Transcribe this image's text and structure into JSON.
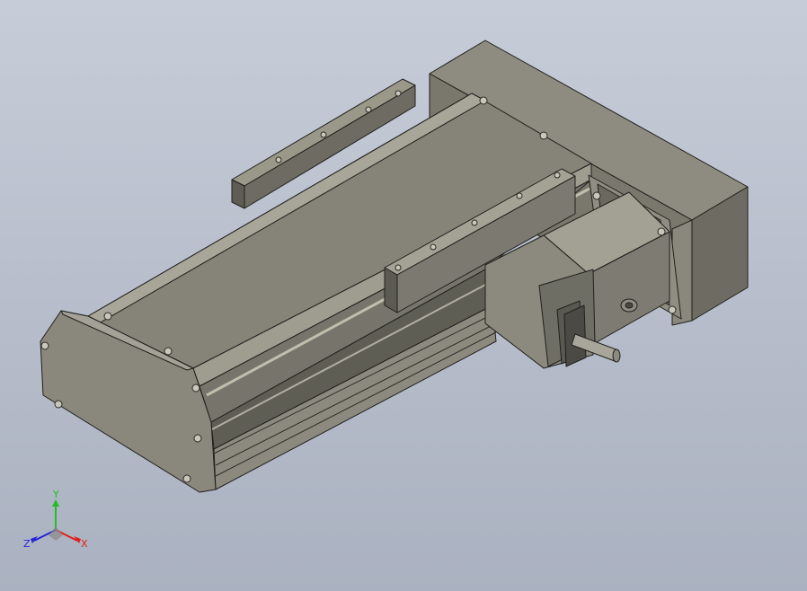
{
  "triad": {
    "x_label": "X",
    "y_label": "Y",
    "z_label": "Z",
    "x_color": "#e0201a",
    "y_color": "#1fbf1f",
    "z_color": "#2424d8"
  },
  "model": {
    "body_color": "#7f7d70",
    "highlight_color": "#a3a194",
    "shadow_color": "#55544c",
    "edge_color": "#1f1f1c"
  }
}
